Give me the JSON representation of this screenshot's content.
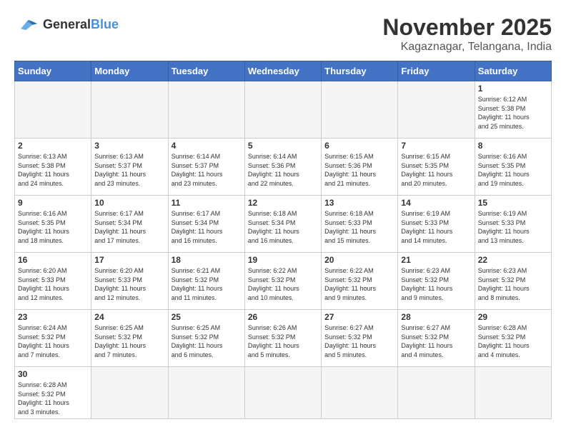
{
  "header": {
    "logo_general": "General",
    "logo_blue": "Blue",
    "month_year": "November 2025",
    "location": "Kagaznagar, Telangana, India"
  },
  "days_of_week": [
    "Sunday",
    "Monday",
    "Tuesday",
    "Wednesday",
    "Thursday",
    "Friday",
    "Saturday"
  ],
  "weeks": [
    [
      {
        "day": "",
        "info": ""
      },
      {
        "day": "",
        "info": ""
      },
      {
        "day": "",
        "info": ""
      },
      {
        "day": "",
        "info": ""
      },
      {
        "day": "",
        "info": ""
      },
      {
        "day": "",
        "info": ""
      },
      {
        "day": "1",
        "info": "Sunrise: 6:12 AM\nSunset: 5:38 PM\nDaylight: 11 hours\nand 25 minutes."
      }
    ],
    [
      {
        "day": "2",
        "info": "Sunrise: 6:13 AM\nSunset: 5:38 PM\nDaylight: 11 hours\nand 24 minutes."
      },
      {
        "day": "3",
        "info": "Sunrise: 6:13 AM\nSunset: 5:37 PM\nDaylight: 11 hours\nand 23 minutes."
      },
      {
        "day": "4",
        "info": "Sunrise: 6:14 AM\nSunset: 5:37 PM\nDaylight: 11 hours\nand 23 minutes."
      },
      {
        "day": "5",
        "info": "Sunrise: 6:14 AM\nSunset: 5:36 PM\nDaylight: 11 hours\nand 22 minutes."
      },
      {
        "day": "6",
        "info": "Sunrise: 6:15 AM\nSunset: 5:36 PM\nDaylight: 11 hours\nand 21 minutes."
      },
      {
        "day": "7",
        "info": "Sunrise: 6:15 AM\nSunset: 5:35 PM\nDaylight: 11 hours\nand 20 minutes."
      },
      {
        "day": "8",
        "info": "Sunrise: 6:16 AM\nSunset: 5:35 PM\nDaylight: 11 hours\nand 19 minutes."
      }
    ],
    [
      {
        "day": "9",
        "info": "Sunrise: 6:16 AM\nSunset: 5:35 PM\nDaylight: 11 hours\nand 18 minutes."
      },
      {
        "day": "10",
        "info": "Sunrise: 6:17 AM\nSunset: 5:34 PM\nDaylight: 11 hours\nand 17 minutes."
      },
      {
        "day": "11",
        "info": "Sunrise: 6:17 AM\nSunset: 5:34 PM\nDaylight: 11 hours\nand 16 minutes."
      },
      {
        "day": "12",
        "info": "Sunrise: 6:18 AM\nSunset: 5:34 PM\nDaylight: 11 hours\nand 16 minutes."
      },
      {
        "day": "13",
        "info": "Sunrise: 6:18 AM\nSunset: 5:33 PM\nDaylight: 11 hours\nand 15 minutes."
      },
      {
        "day": "14",
        "info": "Sunrise: 6:19 AM\nSunset: 5:33 PM\nDaylight: 11 hours\nand 14 minutes."
      },
      {
        "day": "15",
        "info": "Sunrise: 6:19 AM\nSunset: 5:33 PM\nDaylight: 11 hours\nand 13 minutes."
      }
    ],
    [
      {
        "day": "16",
        "info": "Sunrise: 6:20 AM\nSunset: 5:33 PM\nDaylight: 11 hours\nand 12 minutes."
      },
      {
        "day": "17",
        "info": "Sunrise: 6:20 AM\nSunset: 5:33 PM\nDaylight: 11 hours\nand 12 minutes."
      },
      {
        "day": "18",
        "info": "Sunrise: 6:21 AM\nSunset: 5:32 PM\nDaylight: 11 hours\nand 11 minutes."
      },
      {
        "day": "19",
        "info": "Sunrise: 6:22 AM\nSunset: 5:32 PM\nDaylight: 11 hours\nand 10 minutes."
      },
      {
        "day": "20",
        "info": "Sunrise: 6:22 AM\nSunset: 5:32 PM\nDaylight: 11 hours\nand 9 minutes."
      },
      {
        "day": "21",
        "info": "Sunrise: 6:23 AM\nSunset: 5:32 PM\nDaylight: 11 hours\nand 9 minutes."
      },
      {
        "day": "22",
        "info": "Sunrise: 6:23 AM\nSunset: 5:32 PM\nDaylight: 11 hours\nand 8 minutes."
      }
    ],
    [
      {
        "day": "23",
        "info": "Sunrise: 6:24 AM\nSunset: 5:32 PM\nDaylight: 11 hours\nand 7 minutes."
      },
      {
        "day": "24",
        "info": "Sunrise: 6:25 AM\nSunset: 5:32 PM\nDaylight: 11 hours\nand 7 minutes."
      },
      {
        "day": "25",
        "info": "Sunrise: 6:25 AM\nSunset: 5:32 PM\nDaylight: 11 hours\nand 6 minutes."
      },
      {
        "day": "26",
        "info": "Sunrise: 6:26 AM\nSunset: 5:32 PM\nDaylight: 11 hours\nand 5 minutes."
      },
      {
        "day": "27",
        "info": "Sunrise: 6:27 AM\nSunset: 5:32 PM\nDaylight: 11 hours\nand 5 minutes."
      },
      {
        "day": "28",
        "info": "Sunrise: 6:27 AM\nSunset: 5:32 PM\nDaylight: 11 hours\nand 4 minutes."
      },
      {
        "day": "29",
        "info": "Sunrise: 6:28 AM\nSunset: 5:32 PM\nDaylight: 11 hours\nand 4 minutes."
      }
    ],
    [
      {
        "day": "30",
        "info": "Sunrise: 6:28 AM\nSunset: 5:32 PM\nDaylight: 11 hours\nand 3 minutes."
      },
      {
        "day": "",
        "info": ""
      },
      {
        "day": "",
        "info": ""
      },
      {
        "day": "",
        "info": ""
      },
      {
        "day": "",
        "info": ""
      },
      {
        "day": "",
        "info": ""
      },
      {
        "day": "",
        "info": ""
      }
    ]
  ]
}
